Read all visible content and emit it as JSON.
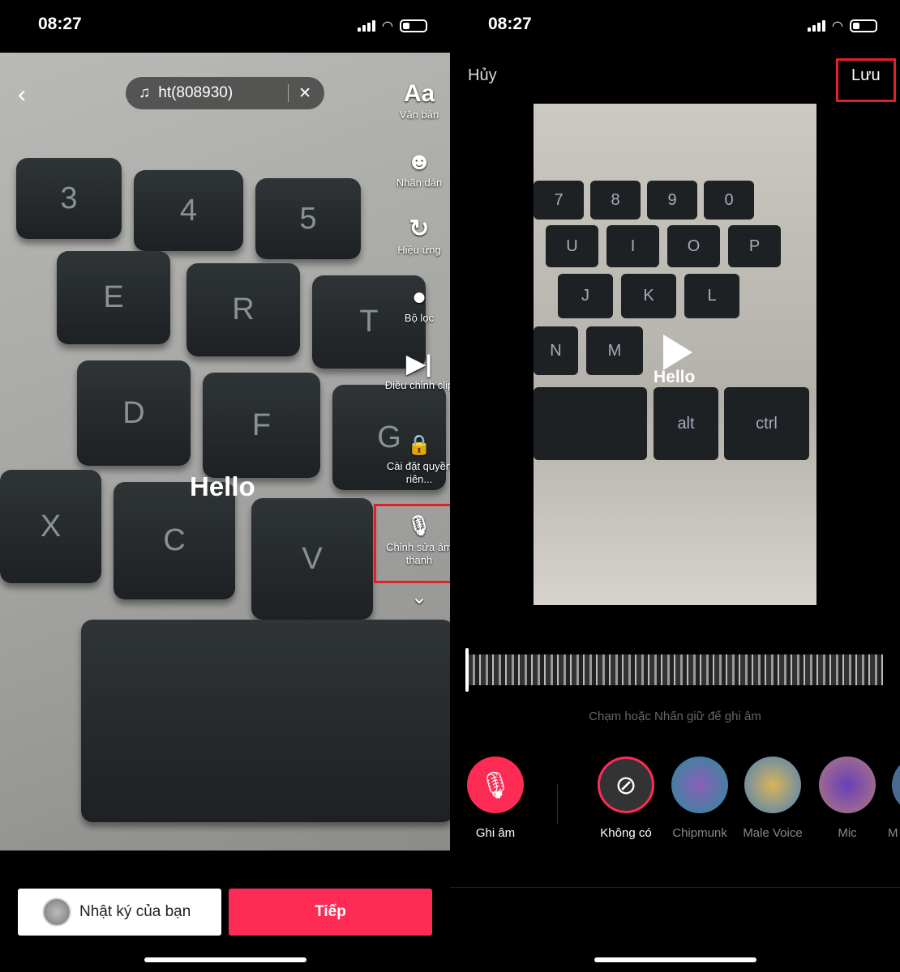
{
  "left": {
    "status": {
      "time": "08:27"
    },
    "music": {
      "label": "ht(808930)",
      "close": "✕"
    },
    "back": "‹",
    "tools": [
      {
        "icon": "Aa",
        "label": "Văn bản"
      },
      {
        "icon": "☻",
        "label": "Nhãn dán"
      },
      {
        "icon": "↻",
        "label": "Hiệu ứng"
      },
      {
        "icon": "●",
        "label": "Bộ lọc"
      },
      {
        "icon": "▶|",
        "label": "Điều chỉnh clip"
      },
      {
        "icon": "🔒",
        "label": "Cài đặt quyền riên..."
      },
      {
        "icon": "🎙",
        "label": "Chỉnh sửa âm thanh"
      }
    ],
    "more": "⌄",
    "overlay_text": "Hello",
    "keys": [
      "3",
      "4",
      "5",
      "E",
      "R",
      "T",
      "D",
      "F",
      "G",
      "X",
      "C",
      "V"
    ],
    "diary_button": "Nhật ký của bạn",
    "next_button": "Tiếp"
  },
  "right": {
    "status": {
      "time": "08:27"
    },
    "cancel": "Hủy",
    "save": "Lưu",
    "overlay_text": "Hello",
    "keys": [
      "7",
      "8",
      "9",
      "0",
      "U",
      "I",
      "O",
      "P",
      "J",
      "K",
      "L",
      "N",
      "M",
      "alt",
      "ctrl"
    ],
    "hint": "Chạm hoặc Nhấn giữ để ghi âm",
    "record": "Ghi âm",
    "effects": [
      {
        "label": "Không có",
        "selected": true
      },
      {
        "label": "Chipmunk"
      },
      {
        "label": "Male Voice"
      },
      {
        "label": "Mic"
      },
      {
        "label": "M"
      }
    ],
    "accent": "#fe2c55"
  }
}
